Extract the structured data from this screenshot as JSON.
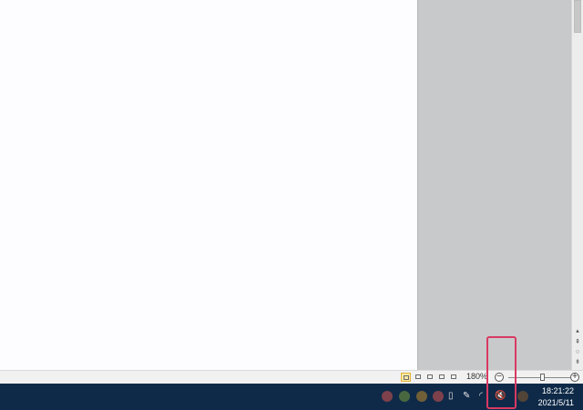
{
  "document": {
    "body_text": ""
  },
  "statusbar": {
    "views": [
      {
        "name": "print-layout",
        "active": true
      },
      {
        "name": "read-mode",
        "active": false
      },
      {
        "name": "web-layout",
        "active": false
      },
      {
        "name": "outline",
        "active": false
      },
      {
        "name": "draft",
        "active": false
      }
    ],
    "zoom_label": "180%",
    "zoom_minus": "−",
    "zoom_plus": "+"
  },
  "scrollbar": {
    "up_glyph": "▴",
    "prev_glyph": "⇞",
    "browse_glyph": "○",
    "next_glyph": "⇟"
  },
  "taskbar": {
    "tray_icons": [
      "app-icon-red",
      "app-icon-green",
      "app-icon-orange",
      "app-icon-red2",
      "usb-icon",
      "pen-icon",
      "wifi-icon",
      "volume-muted-icon",
      "app-icon-dim"
    ],
    "volume_glyph": "🔇",
    "time": "18:21:22",
    "date": "2021/5/11"
  },
  "colors": {
    "taskbar_bg": "#0f2a48",
    "highlight": "#d83a63",
    "page_bg": "#fdfcfe",
    "gutter_bg": "#c8c9cb"
  }
}
